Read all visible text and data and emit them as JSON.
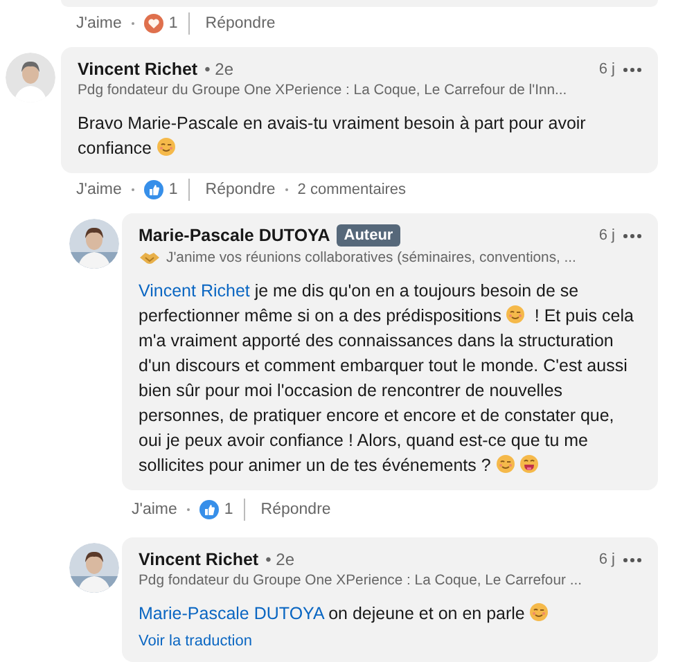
{
  "previous_actions": {
    "like": "J'aime",
    "reaction": {
      "kind": "heart",
      "count": "1"
    },
    "reply": "Répondre"
  },
  "comments": [
    {
      "author": "Vincent Richet",
      "degree": "• 2e",
      "headline": "Pdg fondateur du Groupe One XPerience : La Coque, Le Carrefour de l'Inn...",
      "time": "6 j",
      "body": [
        {
          "kind": "text",
          "text": "Bravo Marie-Pascale en avais-tu vraiment besoin à part pour avoir confiance "
        },
        {
          "kind": "wink"
        }
      ],
      "actions": {
        "like": "J'aime",
        "reaction": {
          "kind": "like",
          "count": "1"
        },
        "reply": "Répondre",
        "comments": "2 commentaires"
      },
      "replies": [
        {
          "author": "Marie-Pascale DUTOYA",
          "badge": "Auteur",
          "headline_icon": true,
          "headline": "J'anime vos réunions collaboratives (séminaires, conventions, ...",
          "time": "6 j",
          "body": [
            {
              "kind": "mention",
              "text": "Vincent Richet"
            },
            {
              "kind": "text",
              "text": " je me dis qu'on en a toujours besoin de se perfectionner même si on a des prédispositions "
            },
            {
              "kind": "wink"
            },
            {
              "kind": "text",
              "text": " ! Et puis cela m'a vraiment apporté des connaissances dans la structuration d'un discours et comment embarquer tout le monde. C'est aussi bien sûr pour moi l'occasion de rencontrer de nouvelles personnes, de pratiquer encore et encore et de constater que, oui je peux avoir confiance ! Alors, quand est-ce que tu me sollicites pour animer un de tes événements ? "
            },
            {
              "kind": "wink"
            },
            {
              "kind": "laugh"
            }
          ],
          "actions": {
            "like": "J'aime",
            "reaction": {
              "kind": "like",
              "count": "1"
            },
            "reply": "Répondre"
          }
        },
        {
          "author": "Vincent Richet",
          "degree": "• 2e",
          "headline": "Pdg fondateur du Groupe One XPerience : La Coque, Le Carrefour ...",
          "time": "6 j",
          "body": [
            {
              "kind": "mention",
              "text": "Marie-Pascale DUTOYA"
            },
            {
              "kind": "text",
              "text": " on dejeune et on en parle "
            },
            {
              "kind": "wink"
            }
          ],
          "translate": "Voir la traduction"
        }
      ]
    }
  ]
}
